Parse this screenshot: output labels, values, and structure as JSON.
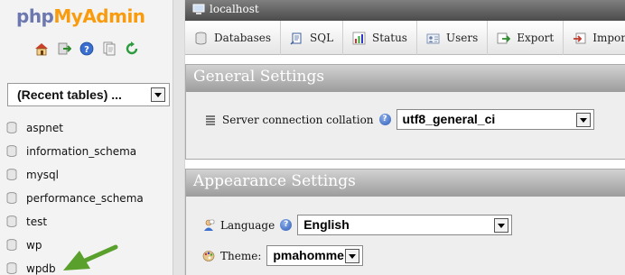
{
  "logo": {
    "part1": "php",
    "part2": "MyAdmin"
  },
  "nav_icons": [
    "home-icon",
    "logout-icon",
    "query-help-icon",
    "docs-icon",
    "reload-icon"
  ],
  "recent_tables": {
    "selected": "(Recent tables) ..."
  },
  "databases": [
    {
      "name": "aspnet"
    },
    {
      "name": "information_schema"
    },
    {
      "name": "mysql"
    },
    {
      "name": "performance_schema"
    },
    {
      "name": "test"
    },
    {
      "name": "wp"
    },
    {
      "name": "wpdb"
    }
  ],
  "server": {
    "label": "localhost"
  },
  "tabs": [
    {
      "label": "Databases",
      "icon": "databases-icon"
    },
    {
      "label": "SQL",
      "icon": "sql-icon"
    },
    {
      "label": "Status",
      "icon": "status-icon"
    },
    {
      "label": "Users",
      "icon": "users-icon"
    },
    {
      "label": "Export",
      "icon": "export-icon"
    },
    {
      "label": "Import",
      "icon": "import-icon"
    }
  ],
  "general_settings": {
    "title": "General Settings",
    "collation_label": "Server connection collation",
    "collation_value": "utf8_general_ci"
  },
  "appearance_settings": {
    "title": "Appearance Settings",
    "language_label": "Language",
    "language_value": "English",
    "theme_label": "Theme:",
    "theme_value": "pmahomme"
  },
  "colors": {
    "logo_php": "#6c78af",
    "logo_myadmin": "#f89c0e",
    "annotation_arrow": "#5aa02c"
  }
}
